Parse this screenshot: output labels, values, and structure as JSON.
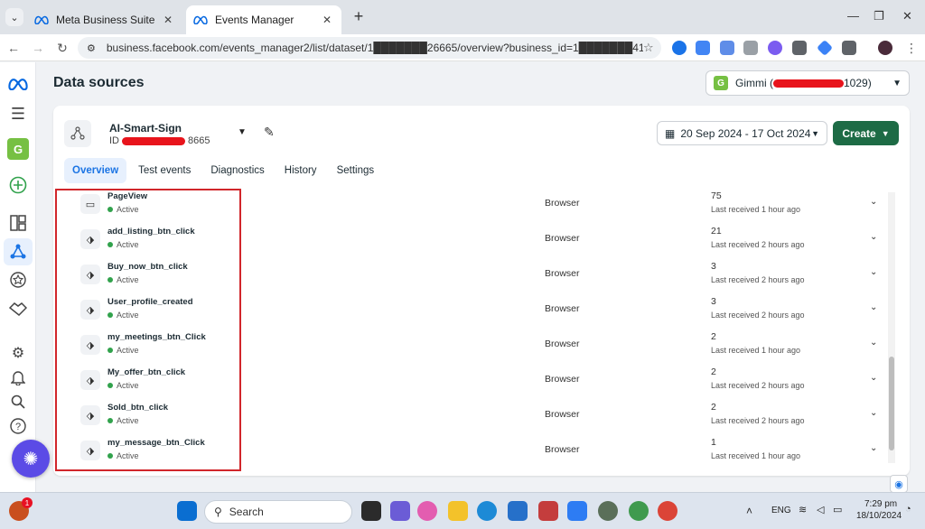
{
  "browser": {
    "tabs": [
      {
        "title": "Meta Business Suite",
        "active": false
      },
      {
        "title": "Events Manager",
        "active": true
      }
    ],
    "url": "business.facebook.com/events_manager2/list/dataset/1███████26665/overview?business_id=1███████41029&nav_..."
  },
  "page": {
    "title": "Data sources",
    "account": {
      "badge": "G",
      "name": "Gimmi (",
      "name_suffix": "1029)"
    }
  },
  "dataset": {
    "name": "AI-Smart-Sign",
    "id_label": "ID",
    "id_suffix": "8665"
  },
  "date_range": "20 Sep 2024 - 17 Oct 2024",
  "create_label": "Create",
  "tabs": [
    "Overview",
    "Test events",
    "Diagnostics",
    "History",
    "Settings"
  ],
  "active_tab": "Overview",
  "events": [
    {
      "name": "PageView",
      "status": "Active",
      "type": "Browser",
      "count": "75",
      "last": "Last received 1 hour ago",
      "icon": "page-icon"
    },
    {
      "name": "add_listing_btn_click",
      "status": "Active",
      "type": "Browser",
      "count": "21",
      "last": "Last received 2 hours ago",
      "icon": "tag-icon"
    },
    {
      "name": "Buy_now_btn_click",
      "status": "Active",
      "type": "Browser",
      "count": "3",
      "last": "Last received 2 hours ago",
      "icon": "tag-icon"
    },
    {
      "name": "User_profile_created",
      "status": "Active",
      "type": "Browser",
      "count": "3",
      "last": "Last received 2 hours ago",
      "icon": "tag-icon"
    },
    {
      "name": "my_meetings_btn_Click",
      "status": "Active",
      "type": "Browser",
      "count": "2",
      "last": "Last received 1 hour ago",
      "icon": "tag-icon"
    },
    {
      "name": "My_offer_btn_click",
      "status": "Active",
      "type": "Browser",
      "count": "2",
      "last": "Last received 2 hours ago",
      "icon": "tag-icon"
    },
    {
      "name": "Sold_btn_click",
      "status": "Active",
      "type": "Browser",
      "count": "2",
      "last": "Last received 2 hours ago",
      "icon": "tag-icon"
    },
    {
      "name": "my_message_btn_Click",
      "status": "Active",
      "type": "Browser",
      "count": "1",
      "last": "Last received 1 hour ago",
      "icon": "tag-icon"
    }
  ],
  "taskbar": {
    "search_placeholder": "Search",
    "lang": "ENG",
    "time": "7:29 pm",
    "date": "18/10/2024",
    "notif_count": "1"
  },
  "colors": {
    "accent_blue": "#1b74e4",
    "create_green": "#1d6b45",
    "active_dot": "#31a24c",
    "highlight_red": "#d1262b"
  }
}
